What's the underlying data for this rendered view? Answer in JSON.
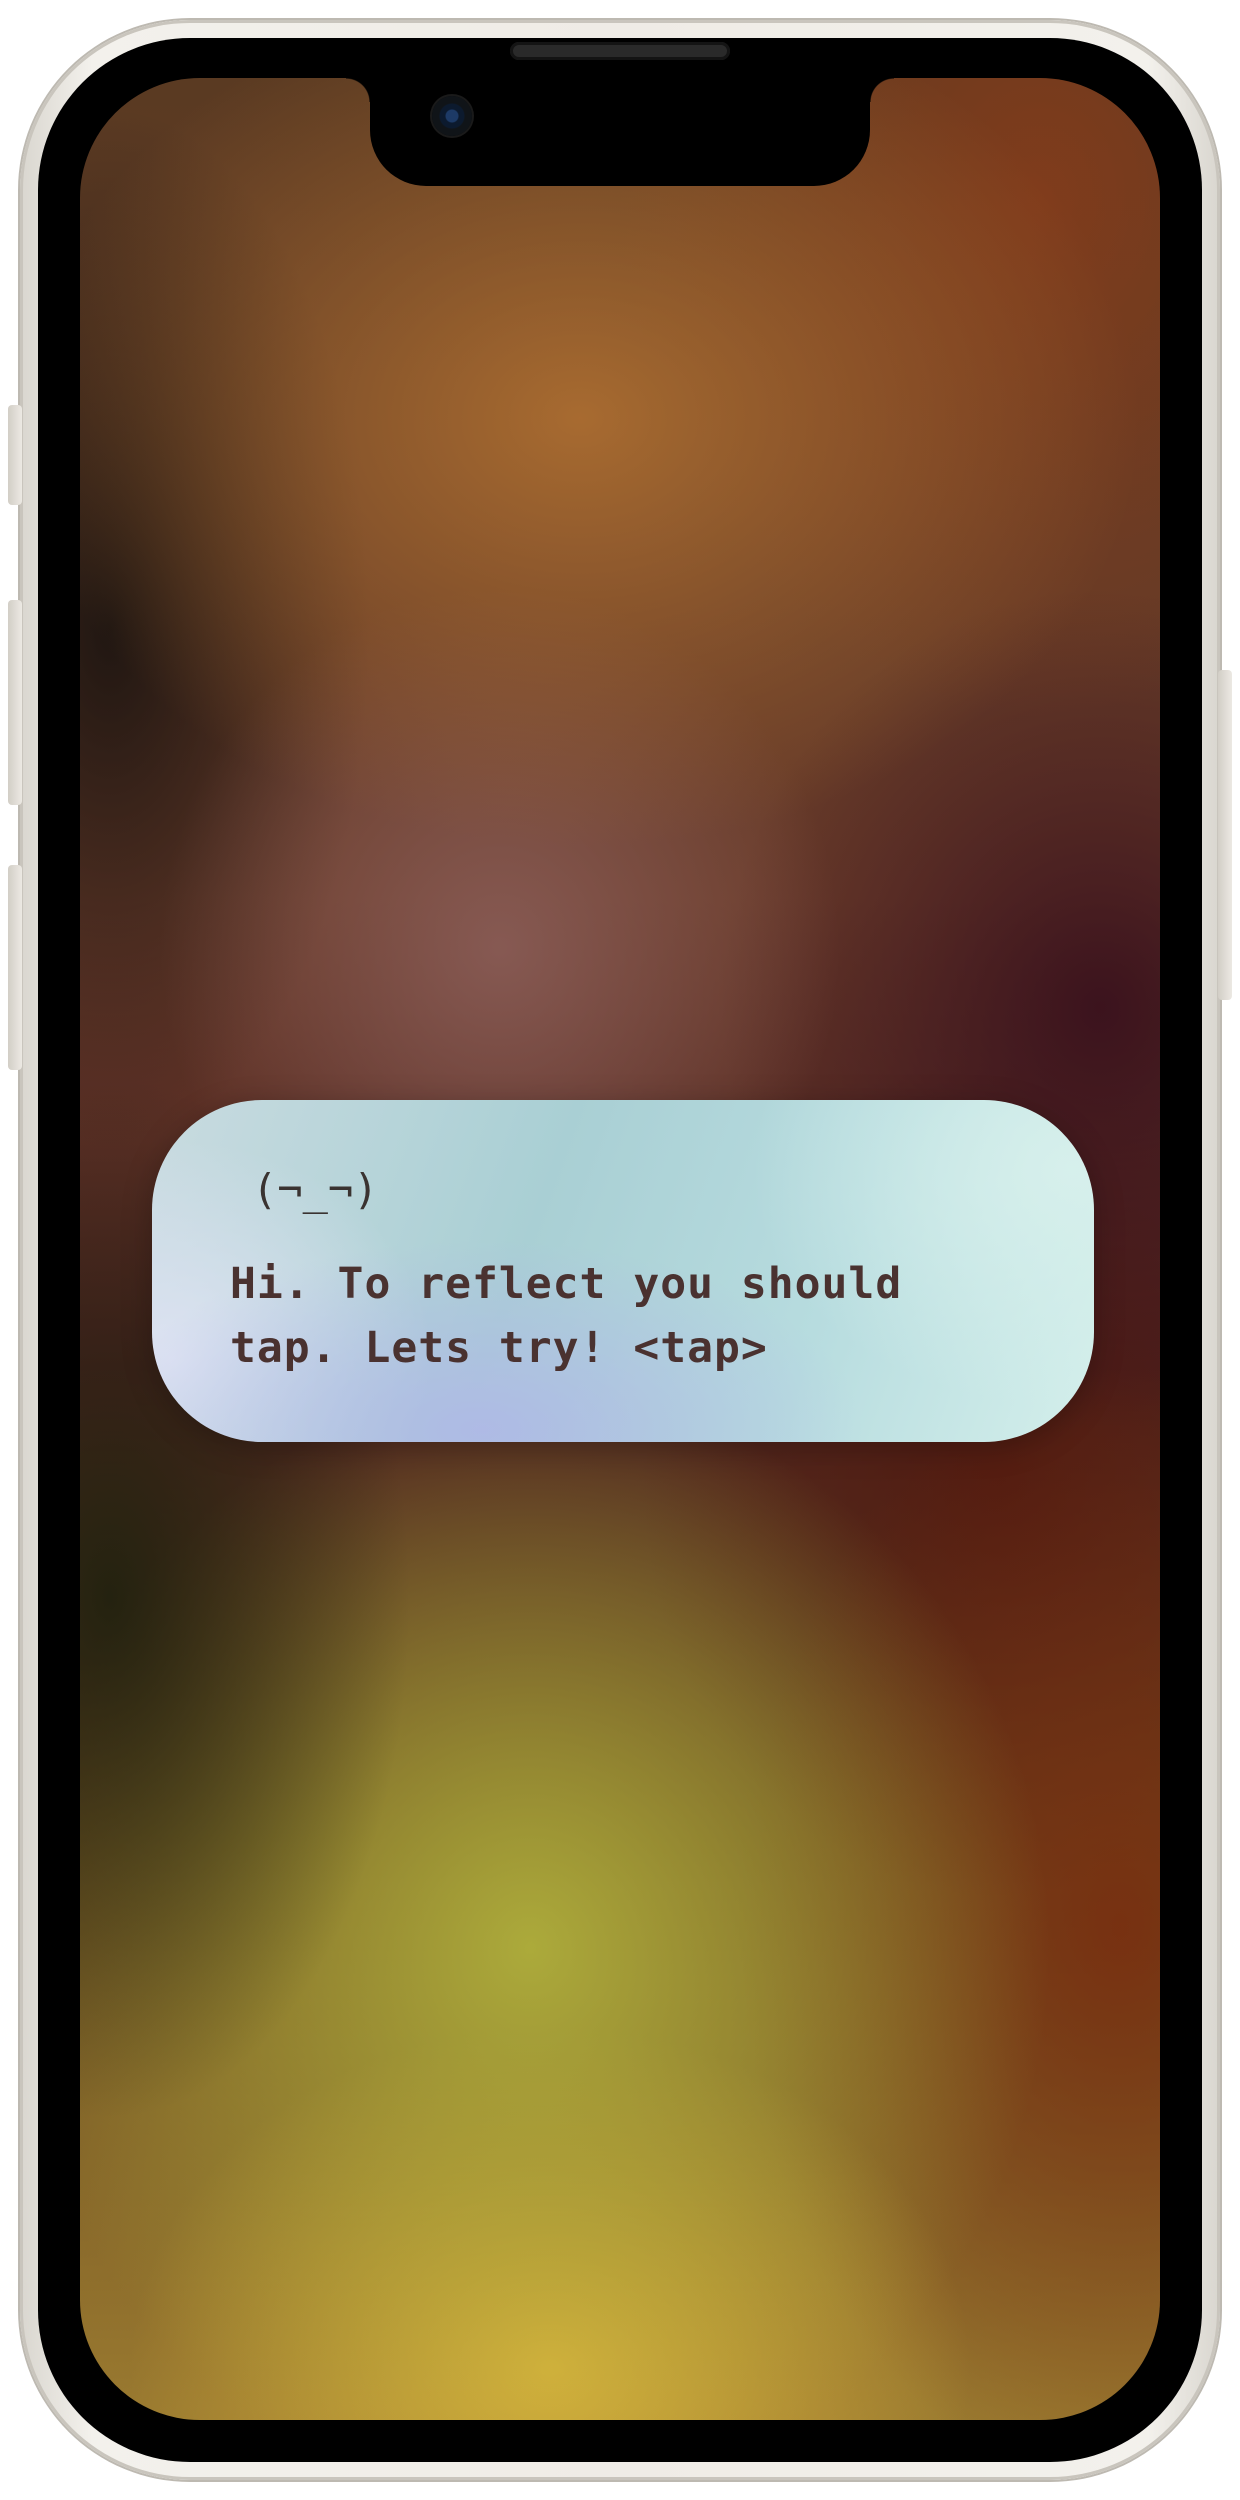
{
  "device": {
    "model_color": "starlight"
  },
  "screen": {
    "dialog": {
      "face": "(¬_¬)",
      "message_lines": [
        "Hi. To reflect you should",
        "tap. Lets try! <tap>"
      ],
      "text_color": "#4a3230"
    }
  },
  "colors": {
    "frame": "#efece6",
    "bezel": "#000000",
    "card_accent": "#a9cfd4"
  }
}
